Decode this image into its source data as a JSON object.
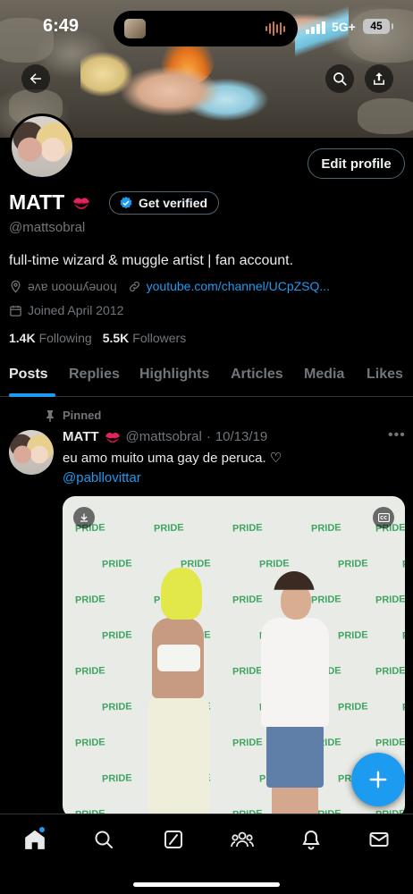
{
  "status_bar": {
    "time": "6:49",
    "network": "5G+",
    "battery": "45"
  },
  "profile": {
    "name": "MATT",
    "name_emoji": "kiss-mark-icon",
    "verify_label": "Get verified",
    "handle": "@mattsobral",
    "bio": "full-time wizard & muggle artist | fan account.",
    "location": "ǝʌɐ uooɯʎǝuoɥ",
    "website": "youtube.com/channel/UCpZSQ...",
    "joined": "Joined April 2012",
    "following_count": "1.4K",
    "following_label": "Following",
    "followers_count": "5.5K",
    "followers_label": "Followers",
    "edit_label": "Edit profile"
  },
  "tabs": [
    {
      "label": "Posts",
      "active": true
    },
    {
      "label": "Replies",
      "active": false
    },
    {
      "label": "Highlights",
      "active": false
    },
    {
      "label": "Articles",
      "active": false
    },
    {
      "label": "Media",
      "active": false
    },
    {
      "label": "Likes",
      "active": false
    }
  ],
  "tweet": {
    "pinned_label": "Pinned",
    "author": "MATT",
    "handle": "@mattsobral",
    "separator": "·",
    "date": "10/13/19",
    "text": "eu amo muito uma gay de peruca. ♡",
    "mention": "@pabllovittar",
    "media_logo_text": "PRIDE"
  },
  "bottom_nav": [
    "home-icon",
    "search-icon",
    "grok-icon",
    "communities-icon",
    "notifications-icon",
    "messages-icon"
  ],
  "colors": {
    "accent": "#1d9bf0",
    "background": "#000000",
    "muted_text": "#71767b",
    "primary_text": "#e7e9ea"
  }
}
